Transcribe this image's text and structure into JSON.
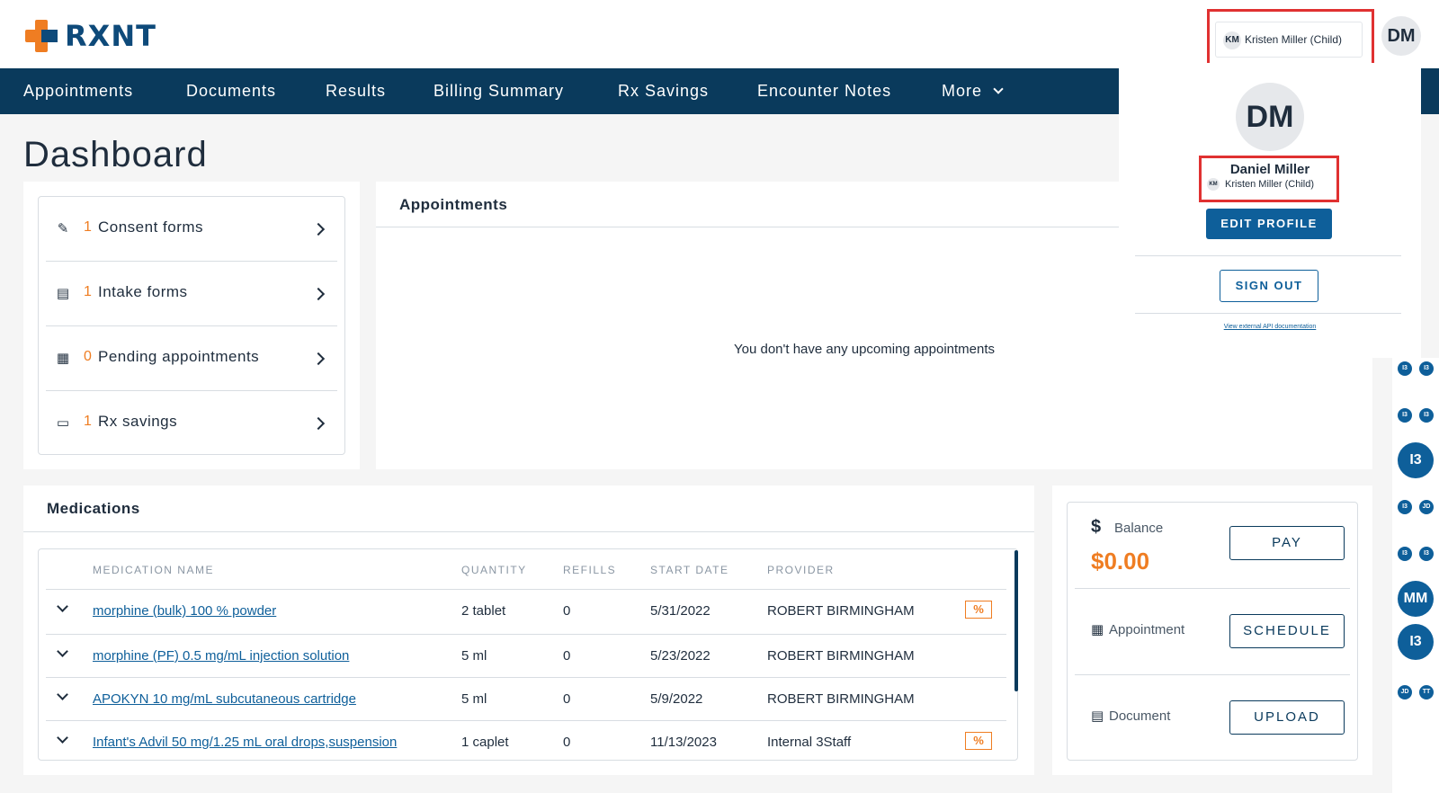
{
  "brand": {
    "logo_text": "RXNT"
  },
  "nav": {
    "items": [
      "Appointments",
      "Documents",
      "Results",
      "Billing Summary",
      "Rx Savings",
      "Encounter Notes",
      "More"
    ]
  },
  "page": {
    "title": "Dashboard"
  },
  "tasks": [
    {
      "count": "1",
      "label": "Consent forms",
      "icon": "edit-form-icon"
    },
    {
      "count": "1",
      "label": "Intake forms",
      "icon": "clipboard-icon"
    },
    {
      "count": "0",
      "label": "Pending appointments",
      "icon": "calendar-icon"
    },
    {
      "count": "1",
      "label": "Rx savings",
      "icon": "coupon-icon"
    }
  ],
  "appointments": {
    "title": "Appointments",
    "empty": "You don't have any upcoming appointments"
  },
  "medications": {
    "title": "Medications",
    "headers": [
      "MEDICATION NAME",
      "QUANTITY",
      "REFILLS",
      "START DATE",
      "PROVIDER"
    ],
    "rows": [
      {
        "name": "morphine (bulk) 100 % powder",
        "quantity": "2 tablet",
        "refills": "0",
        "start": "5/31/2022",
        "provider": "ROBERT BIRMINGHAM",
        "coupon": "%"
      },
      {
        "name": "morphine (PF) 0.5 mg/mL injection solution",
        "quantity": "5 ml",
        "refills": "0",
        "start": "5/23/2022",
        "provider": "ROBERT BIRMINGHAM",
        "coupon": ""
      },
      {
        "name": "APOKYN 10 mg/mL subcutaneous cartridge",
        "quantity": "5 ml",
        "refills": "0",
        "start": "5/9/2022",
        "provider": "ROBERT BIRMINGHAM",
        "coupon": ""
      },
      {
        "name": "Infant's Advil 50 mg/1.25 mL oral drops,suspension",
        "quantity": "1 caplet",
        "refills": "0",
        "start": "11/13/2023",
        "provider": "Internal 3Staff",
        "coupon": "%"
      }
    ]
  },
  "account": {
    "balance_label": "Balance",
    "balance_amount": "$0.00",
    "pay_label": "PAY",
    "appointment_label": "Appointment",
    "schedule_label": "SCHEDULE",
    "document_label": "Document",
    "upload_label": "UPLOAD"
  },
  "user": {
    "chip_initials": "KM",
    "chip_name": "Kristen Miller (Child)",
    "avatar_initials": "DM",
    "full_name": "Daniel Miller",
    "edit_profile": "EDIT PROFILE",
    "sign_out": "SIGN OUT",
    "api_link": "View external API documentation"
  },
  "side_avatars": [
    "I3",
    "I3",
    "I3",
    "I3",
    "I3",
    "I3",
    "JD",
    "I3",
    "I3",
    "MM",
    "I3",
    "JD",
    "TT"
  ],
  "colors": {
    "navy": "#0a3a5c",
    "accent": "#ef7d22",
    "link": "#0e5f9a",
    "highlight": "#e03131"
  }
}
